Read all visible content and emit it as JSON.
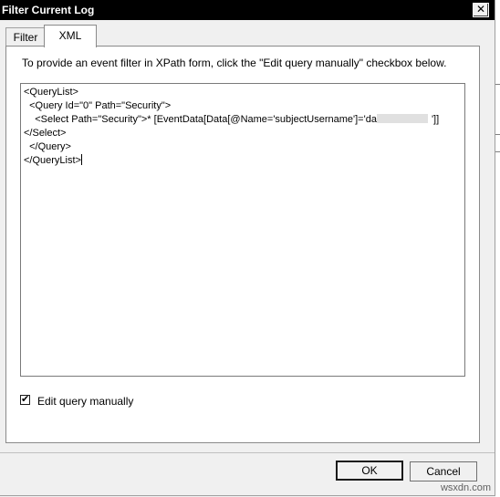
{
  "dialog": {
    "title": "Filter Current Log",
    "close_glyph": "✕"
  },
  "tabs": [
    {
      "label": "Filter"
    },
    {
      "label": "XML"
    }
  ],
  "panel": {
    "instruction": "To provide an event filter in XPath form, click the \"Edit query manually\" checkbox below.",
    "query_lines": [
      "<QueryList>",
      "  <Query Id=\"0\" Path=\"Security\">",
      "    <Select Path=\"Security\">* [EventData[Data[@Name='subjectUsername']='da",
      "</Select>",
      "  </Query>",
      "</QueryList>"
    ],
    "query_line3_end": "']]",
    "checkbox_checked_glyph": "✔",
    "checkbox_label": "Edit query manually"
  },
  "buttons": {
    "ok": "OK",
    "cancel": "Cancel"
  },
  "watermark": "wsxdn.com"
}
